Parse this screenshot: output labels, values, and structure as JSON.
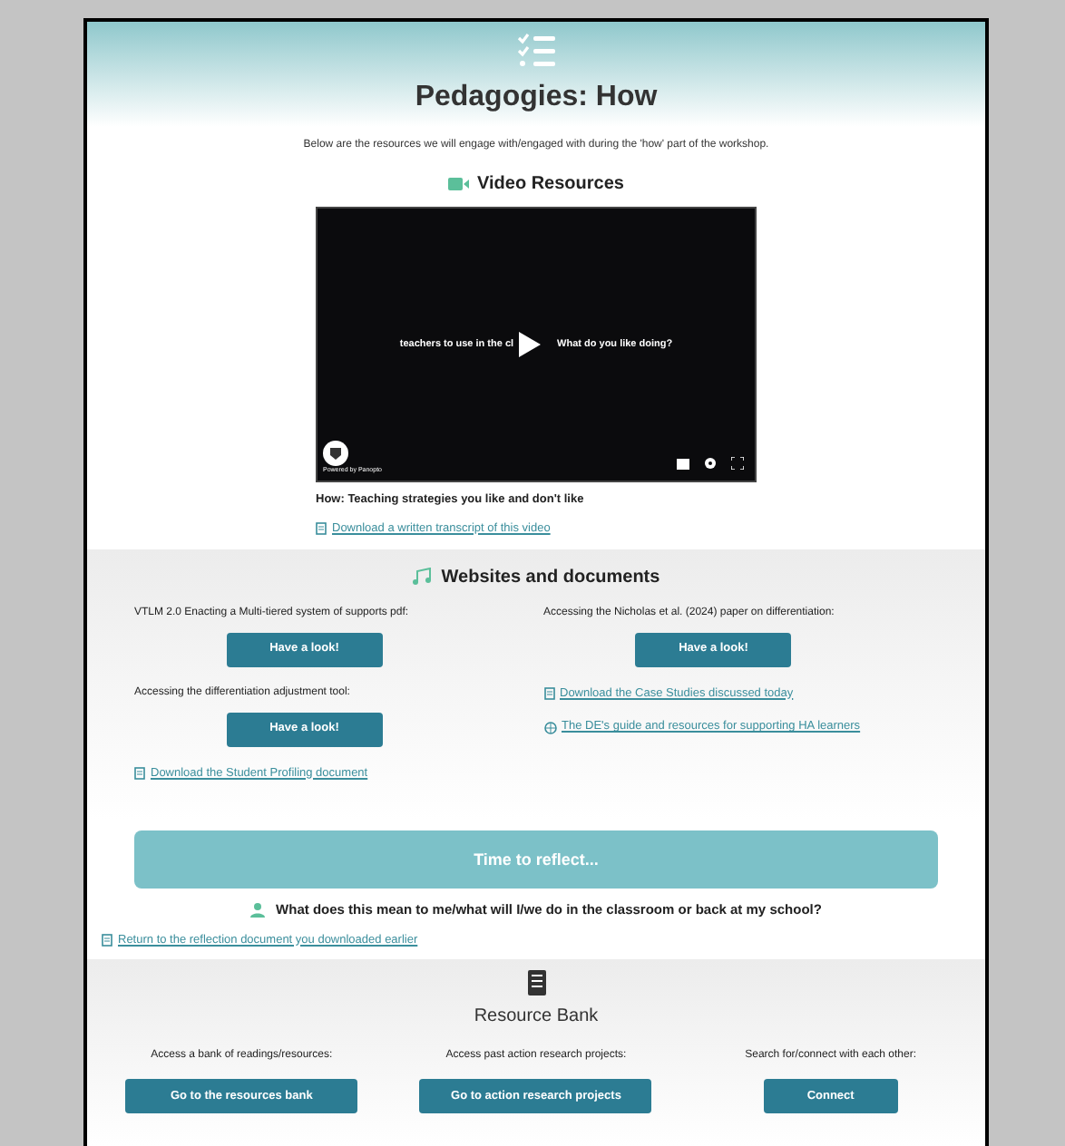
{
  "header": {
    "title": "Pedagogies: How",
    "intro": "Below are the resources we will engage with/engaged with during the 'how' part of the workshop."
  },
  "video_section": {
    "heading": "Video Resources",
    "video": {
      "caption_left": "teachers to use in the cl",
      "caption_right": "What do you like doing?",
      "powered_by": "Powered by Panopto"
    },
    "video_title": "How: Teaching strategies you like and don't like",
    "transcript_link": "Download a written transcript of this video"
  },
  "websites_section": {
    "heading": "Websites and documents",
    "columns": [
      {
        "items": [
          {
            "kind": "button",
            "label": "VTLM 2.0 Enacting a Multi-tiered system of supports pdf:",
            "button": "Have a look!"
          },
          {
            "kind": "button",
            "label": "Accessing the differentiation adjustment tool:",
            "button": "Have a look!"
          },
          {
            "kind": "link",
            "link": "Download the Student Profiling document"
          }
        ]
      },
      {
        "items": [
          {
            "kind": "button",
            "label": "Accessing the Nicholas et al. (2024) paper on differentiation:",
            "button": "Have a look!"
          },
          {
            "kind": "link",
            "link": "Download the Case Studies discussed today"
          },
          {
            "kind": "web",
            "link": "The DE's guide and resources for supporting HA learners"
          }
        ]
      }
    ]
  },
  "reflect_section": {
    "banner": "Time to reflect...",
    "question": "What does this mean to me/what will I/we do in the classroom or back at my school?",
    "link": "Return to the reflection document you downloaded earlier"
  },
  "resource_bank": {
    "heading": "Resource Bank",
    "columns": [
      {
        "label": "Access a bank of readings/resources:",
        "button": "Go to the resources bank"
      },
      {
        "label": "Access past action research projects:",
        "button": "Go to action research projects"
      },
      {
        "label": "Search for/connect with each other:",
        "button": "Connect"
      }
    ]
  }
}
